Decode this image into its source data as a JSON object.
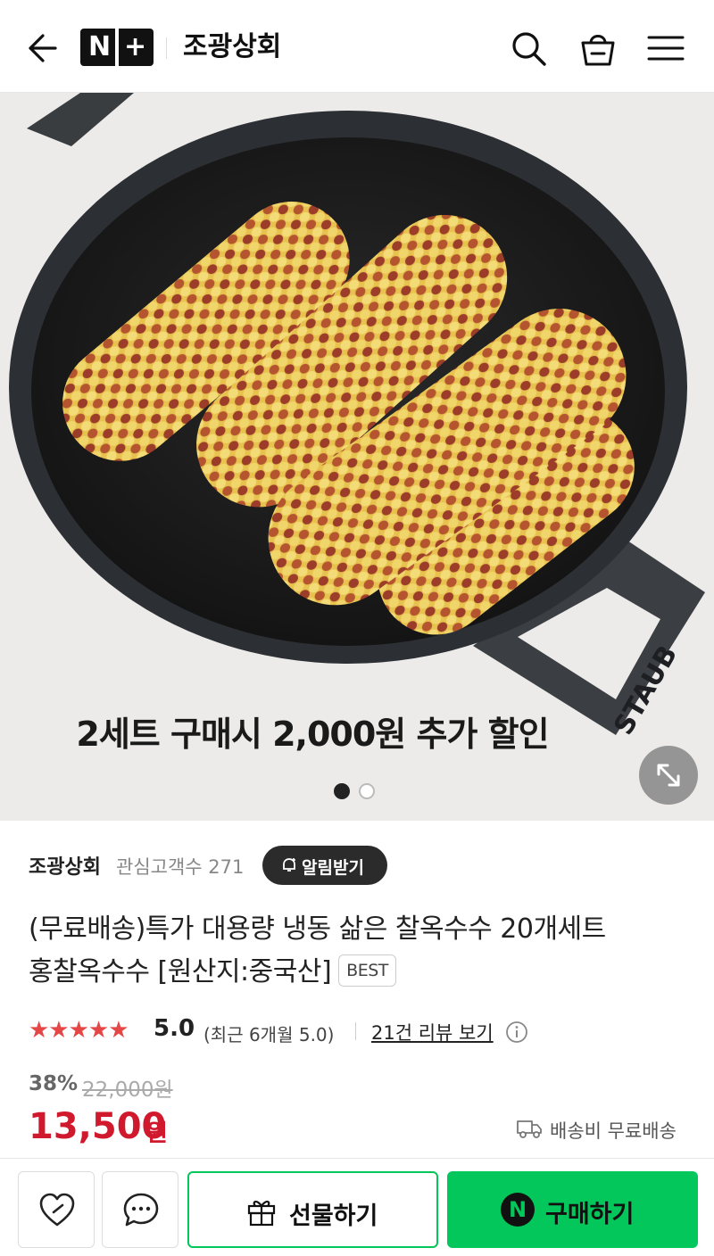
{
  "header": {
    "logo_text": "N+",
    "store_name": "조광상회",
    "icons": [
      "back-arrow-icon",
      "search-icon",
      "shopping-bag-icon",
      "hamburger-menu-icon"
    ]
  },
  "hero": {
    "caption": "2세트 구매시 2,000원 추가 할인",
    "pan_brand": "STAUB",
    "pagination": {
      "current": 1,
      "total": 2
    },
    "expand_icon": "expand-icon"
  },
  "store": {
    "name": "조광상회",
    "interest_label": "관심고객수 271",
    "notify_label": "알림받기"
  },
  "product": {
    "title_line1": "(무료배송)특가 대용량 냉동 삶은 찰옥수수 20개세트",
    "title_line2": "홍찰옥수수 [원산지:중국산]",
    "badge": "BEST"
  },
  "rating": {
    "stars": "★★★★★",
    "star_count": 5,
    "score": "5.0",
    "recent": "(최근 6개월 5.0)",
    "review_link": "21건 리뷰 보기"
  },
  "price": {
    "discount_rate": "38%",
    "original": "22,000원",
    "sale_value": "13,500",
    "sale_unit": "원",
    "shipping": "배송비 무료배송"
  },
  "bottom_bar": {
    "gift_label": "선물하기",
    "buy_label": "구매하기",
    "buy_icon_text": "N"
  },
  "colors": {
    "price_red": "#d1192e",
    "naver_green": "#03c75a",
    "star_red": "#e54747"
  }
}
